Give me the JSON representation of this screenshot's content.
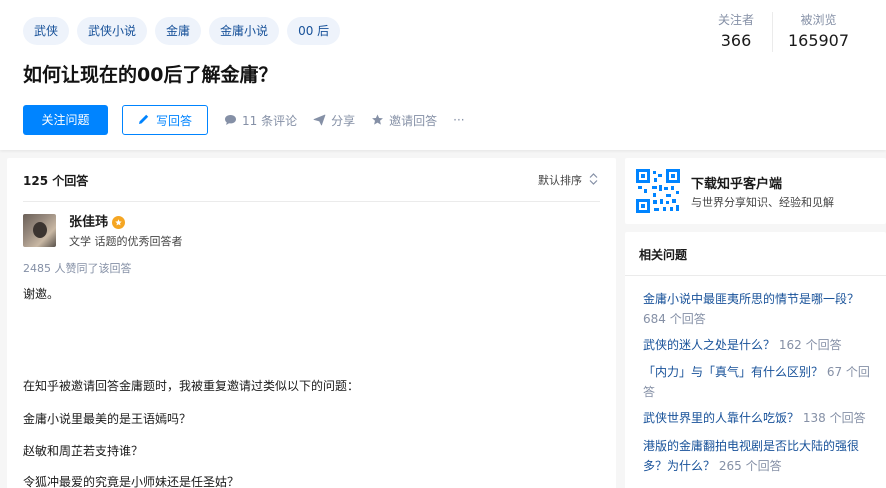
{
  "topics": [
    "武侠",
    "武侠小说",
    "金庸",
    "金庸小说",
    "00 后"
  ],
  "question": {
    "title": "如何让现在的00后了解金庸？"
  },
  "stats": {
    "followers_label": "关注者",
    "followers": "366",
    "views_label": "被浏览",
    "views": "165907"
  },
  "actions": {
    "follow": "关注问题",
    "write": "写回答",
    "comments": "11 条评论",
    "share": "分享",
    "invite": "邀请回答",
    "more": "···"
  },
  "answers": {
    "count": "125 个回答",
    "sort": "默认排序"
  },
  "answer": {
    "author": "张佳玮",
    "bio": "文学 话题的优秀回答者",
    "votes": "2485 人赞同了该回答",
    "paragraphs": [
      "谢邀。",
      "在知乎被邀请回答金庸题时，我被重复邀请过类似以下的问题：",
      "金庸小说里最美的是王语嫣吗？",
      "赵敏和周芷若支持谁？",
      "令狐冲最爱的究竟是小师妹还是任圣姑？"
    ]
  },
  "download": {
    "title": "下载知乎客户端",
    "subtitle": "与世界分享知识、经验和见解"
  },
  "related": {
    "title": "相关问题",
    "items": [
      {
        "line1": "金庸小说中最匪夷所思的情节是哪一段？",
        "line2_q": "",
        "count": "684 个回答"
      },
      {
        "line1": "武侠的迷人之处是什么？",
        "line2_q": "",
        "count": "162 个回答"
      },
      {
        "line1": "「内力」与「真气」有什么区别？",
        "line2_q": "",
        "count": "67 个回答"
      },
      {
        "line1": "武侠世界里的人靠什么吃饭？",
        "line2_q": "",
        "count": "138 个回答"
      },
      {
        "line1": "港版的金庸翻拍电视剧是否比大陆的强很",
        "line2_q": "多？为什么？",
        "count": "265 个回答"
      }
    ]
  }
}
